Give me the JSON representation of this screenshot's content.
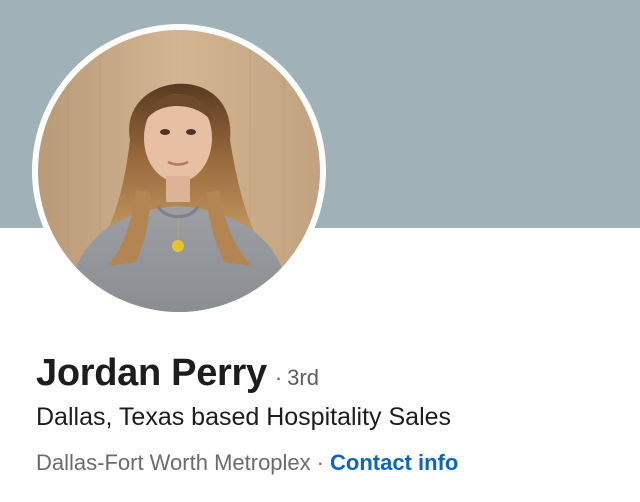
{
  "profile": {
    "name": "Jordan Perry",
    "separator": "·",
    "connection_degree": "3rd",
    "headline": "Dallas, Texas based Hospitality Sales",
    "location": "Dallas-Fort Worth Metroplex",
    "contact_link": "Contact info"
  },
  "colors": {
    "cover": "#a0b1b8",
    "name_text": "#1d1d1d",
    "muted_text": "#6b6b6b",
    "link": "#0a66c2"
  }
}
